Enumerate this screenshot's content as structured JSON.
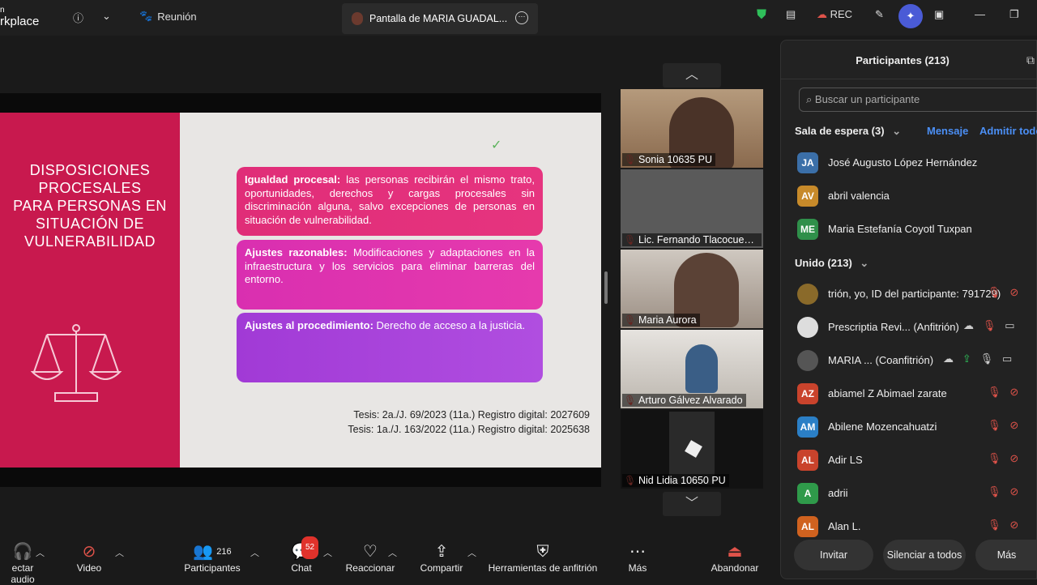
{
  "topbar": {
    "brand_small": "n",
    "brand": "rkplace",
    "meeting_label": "Reunión",
    "share_tab_label": "Pantalla de MARIA GUADAL...",
    "rec_label": "REC"
  },
  "slide": {
    "title_lines": [
      "DISPOSICIONES",
      "PROCESALES",
      "PARA PERSONAS EN",
      "SITUACIÓN DE",
      "VULNERABILIDAD"
    ],
    "box1_head": "Igualdad procesal:",
    "box1_text": " las personas recibirán el mismo trato, oportunidades, derechos y cargas procesales sin discriminación alguna, salvo excepciones de personas en situación de vulnerabilidad.",
    "box2_head": "Ajustes razonables:",
    "box2_text": " Modificaciones y adaptaciones en la infraestructura y los servicios para eliminar barreras del entorno.",
    "box3_head": "Ajustes al procedimiento:",
    "box3_text": " Derecho de acceso a la justicia.",
    "tesis1": "Tesis: 2a./J. 69/2023 (11a.)  Registro digital: 2027609",
    "tesis2": "Tesis:  1a./J. 163/2022 (11a.) Registro digital: 2025638"
  },
  "gallery": {
    "tiles": [
      {
        "name": "Sonia 10635 PU"
      },
      {
        "name": "Lic. Fernando Tlacocuentzi..."
      },
      {
        "name": "Maria Aurora"
      },
      {
        "name": "Arturo Gálvez Alvarado"
      },
      {
        "name": "Nid Lidia 10650 PU"
      }
    ]
  },
  "panel": {
    "title": "Participantes (213)",
    "search_placeholder": "Buscar un participante",
    "waiting_label": "Sala de espera (3)",
    "message_link": "Mensaje",
    "admit_link": "Admitir todo",
    "waiting": [
      {
        "initials": "JA",
        "name": "José Augusto López Hernández",
        "color": "#3b6fa8"
      },
      {
        "initials": "AV",
        "name": "abril valencia",
        "color": "#c78a2a"
      },
      {
        "initials": "ME",
        "name": "Maria Estefanía Coyotl Tuxpan",
        "color": "#2f8f4a"
      }
    ],
    "joined_label": "Unido (213)",
    "joined": [
      {
        "initials": "",
        "name": "trión, yo, ID del participante: 791729)",
        "color": "#8a6a2a"
      },
      {
        "initials": "",
        "name": "Prescriptia Revi... (Anfitrión)",
        "color": "#ddd"
      },
      {
        "initials": "",
        "name": "MARIA ... (Coanfitrión)",
        "color": "#555"
      },
      {
        "initials": "AZ",
        "name": "abiamel Z Abimael zarate",
        "color": "#c9432c"
      },
      {
        "initials": "AM",
        "name": "Abilene Mozencahuatzi",
        "color": "#2b7fc6"
      },
      {
        "initials": "AL",
        "name": "Adir LS",
        "color": "#c9432c"
      },
      {
        "initials": "A",
        "name": "adrii",
        "color": "#2f9a4a"
      },
      {
        "initials": "AL",
        "name": "Alan L.",
        "color": "#d0621f"
      }
    ],
    "invite_label": "Invitar",
    "mute_all_label": "Silenciar a todos",
    "more_label": "Más"
  },
  "toolbar": {
    "audio_label": "ectar audio",
    "video_label": "Video",
    "participants_label": "Participantes",
    "participants_count": "216",
    "chat_label": "Chat",
    "chat_badge": "52",
    "react_label": "Reaccionar",
    "share_label": "Compartir",
    "host_tools_label": "Herramientas de anfitrión",
    "more_label": "Más",
    "leave_label": "Abandonar"
  }
}
